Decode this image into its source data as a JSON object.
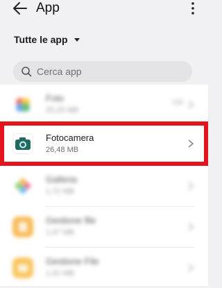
{
  "header": {
    "title": "App",
    "back_icon": "arrow-left-icon",
    "menu_icon": "more-vertical-icon"
  },
  "filter": {
    "label": "Tutte le app",
    "icon": "caret-down-icon"
  },
  "search": {
    "placeholder": "Cerca app",
    "icon": "search-icon"
  },
  "apps": [
    {
      "name": "Foto",
      "size": "25,25 MB",
      "extra": "GB",
      "icon": "photos-icon"
    },
    {
      "name": "Fotocamera",
      "size": "26,48 MB",
      "icon": "camera-icon"
    },
    {
      "name": "Galleria",
      "size": "1,72 MB",
      "icon": "gallery-icon"
    },
    {
      "name": "Gestione file",
      "size": "1,47 MB",
      "icon": "file-manager-icon"
    },
    {
      "name": "Gestione File",
      "size": "1,52 MB",
      "icon": "file-manager-icon"
    }
  ],
  "colors": {
    "highlight": "#e2141c",
    "camera_body": "#1f6b62"
  }
}
